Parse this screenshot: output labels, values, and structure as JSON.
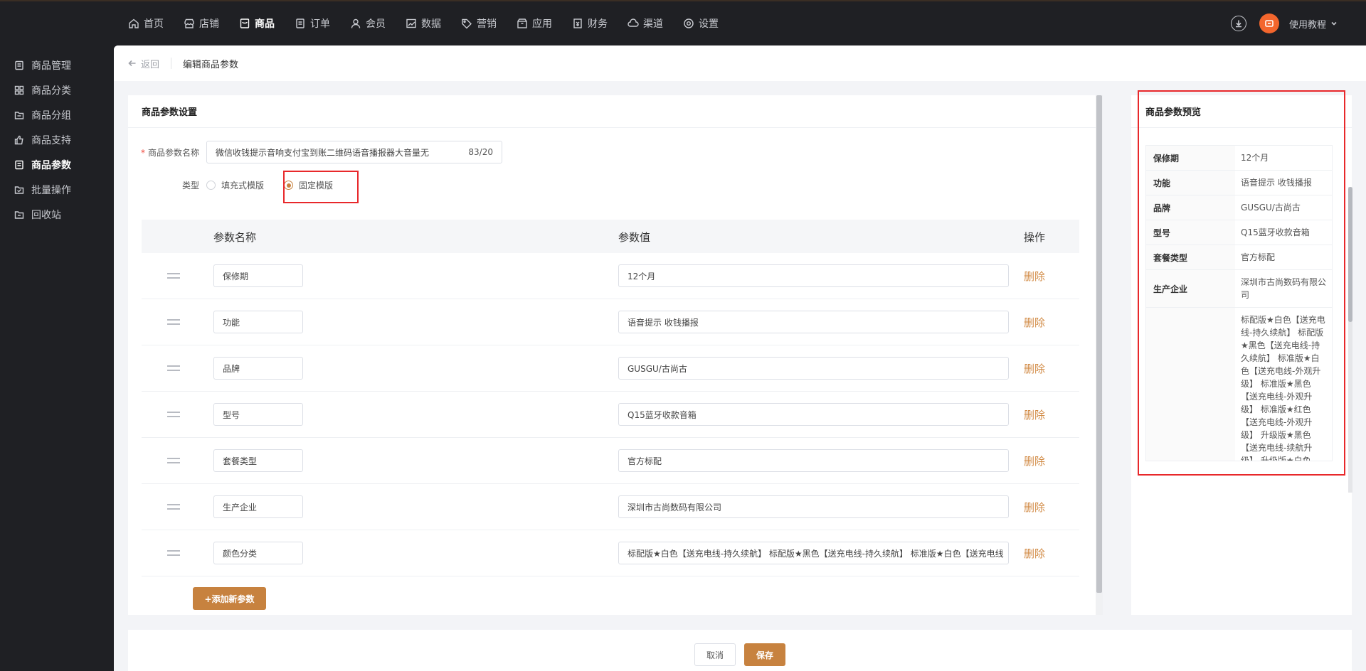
{
  "topnav": {
    "items": [
      {
        "label": "首页",
        "icon": "home-icon"
      },
      {
        "label": "店铺",
        "icon": "store-icon"
      },
      {
        "label": "商品",
        "icon": "goods-icon",
        "active": true
      },
      {
        "label": "订单",
        "icon": "order-icon"
      },
      {
        "label": "会员",
        "icon": "user-icon"
      },
      {
        "label": "数据",
        "icon": "chart-icon"
      },
      {
        "label": "营销",
        "icon": "tag-icon"
      },
      {
        "label": "应用",
        "icon": "box-icon"
      },
      {
        "label": "财务",
        "icon": "finance-icon"
      },
      {
        "label": "渠道",
        "icon": "channel-icon"
      },
      {
        "label": "设置",
        "icon": "gear-icon"
      }
    ],
    "tutorial_label": "使用教程"
  },
  "sidebar": {
    "items": [
      {
        "label": "商品管理"
      },
      {
        "label": "商品分类"
      },
      {
        "label": "商品分组"
      },
      {
        "label": "商品支持"
      },
      {
        "label": "商品参数",
        "active": true
      },
      {
        "label": "批量操作"
      },
      {
        "label": "回收站"
      }
    ]
  },
  "breadcrumb": {
    "back_label": "返回",
    "title": "编辑商品参数"
  },
  "settings_card": {
    "title": "商品参数设置",
    "name_label": "商品参数名称",
    "name_value": "微信收钱提示音响支付宝到账二维码语音播报器大音量无",
    "name_counter": "83/20",
    "type_label": "类型",
    "type_options": [
      "填充式模版",
      "固定模版"
    ],
    "type_selected": "固定模版"
  },
  "param_table": {
    "headers": {
      "name": "参数名称",
      "value": "参数值",
      "op": "操作"
    },
    "delete_label": "删除",
    "rows": [
      {
        "name": "保修期",
        "value": "12个月"
      },
      {
        "name": "功能",
        "value": "语音提示 收钱播报"
      },
      {
        "name": "品牌",
        "value": "GUSGU/古尚古"
      },
      {
        "name": "型号",
        "value": "Q15蓝牙收款音箱"
      },
      {
        "name": "套餐类型",
        "value": "官方标配"
      },
      {
        "name": "生产企业",
        "value": "深圳市古尚数码有限公司"
      },
      {
        "name": "颜色分类",
        "value": "标配版★白色【送充电线-持久续航】 标配版★黑色【送充电线-持久续航】 标准版★白色【送充电线"
      }
    ],
    "add_label": "+添加新参数"
  },
  "preview": {
    "title": "商品参数预览",
    "rows": [
      {
        "key": "保修期",
        "value": "12个月"
      },
      {
        "key": "功能",
        "value": "语音提示 收钱播报"
      },
      {
        "key": "品牌",
        "value": "GUSGU/古尚古"
      },
      {
        "key": "型号",
        "value": "Q15蓝牙收款音箱"
      },
      {
        "key": "套餐类型",
        "value": "官方标配"
      },
      {
        "key": "生产企业",
        "value": "深圳市古尚数码有限公司"
      },
      {
        "key": "",
        "value": "标配版★白色【送充电线-持久续航】 标配版★黑色【送充电线-持久续航】 标准版★白色【送充电线-外观升级】 标准版★黑色【送充电线-外观升级】 标准版★红色【送充电线-外观升级】 升级版★黑色【送充电线-续航升级】 升级版★白色【送充电线-续航升"
      }
    ]
  },
  "footer": {
    "cancel_label": "取消",
    "save_label": "保存"
  },
  "colors": {
    "accent": "#c7823f",
    "delete": "#d18a44",
    "highlight": "#e8282b",
    "avatar": "#f3662d",
    "sidebar_bg": "#1f2024"
  }
}
